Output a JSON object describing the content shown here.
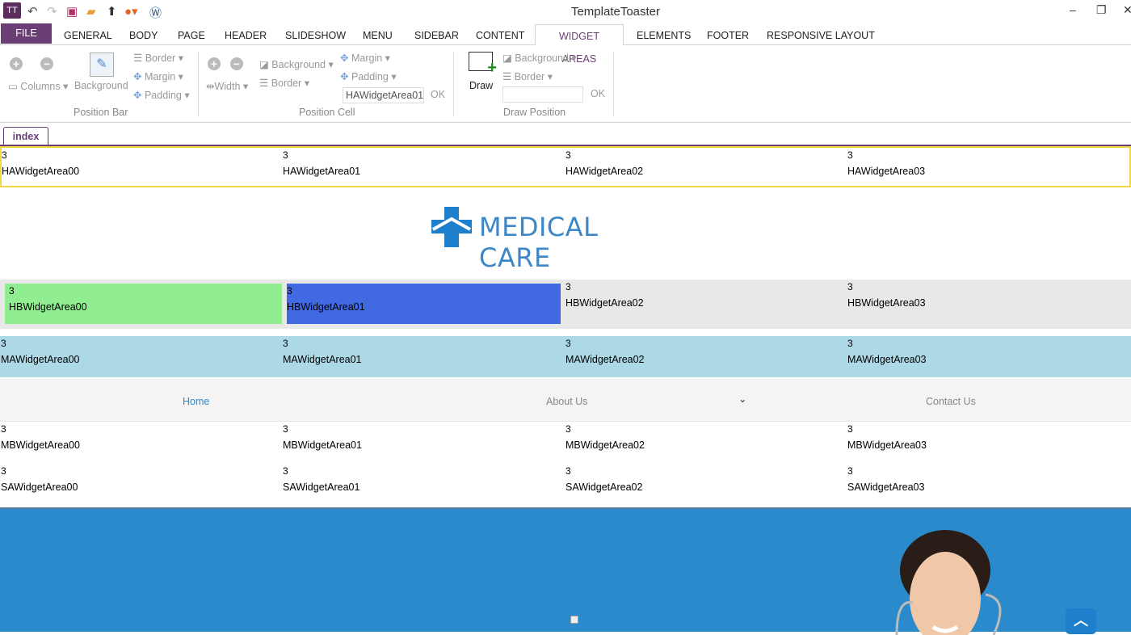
{
  "app": {
    "title": "TemplateToaster",
    "logo": "TT"
  },
  "quick_access": [
    "undo-icon",
    "redo-icon",
    "save-icon",
    "open-folder-icon",
    "upload-icon",
    "firefox-icon",
    "wordpress-icon"
  ],
  "tabs": [
    {
      "label": "FILE"
    },
    {
      "label": "GENERAL"
    },
    {
      "label": "BODY"
    },
    {
      "label": "PAGE"
    },
    {
      "label": "HEADER"
    },
    {
      "label": "SLIDESHOW"
    },
    {
      "label": "MENU"
    },
    {
      "label": "SIDEBAR"
    },
    {
      "label": "CONTENT"
    },
    {
      "label": "WIDGET AREAS"
    },
    {
      "label": "ELEMENTS"
    },
    {
      "label": "FOOTER"
    },
    {
      "label": "RESPONSIVE LAYOUT"
    }
  ],
  "ribbon": {
    "position_bar": {
      "label": "Position Bar",
      "columns": "Columns",
      "background": "Background",
      "border": "Border",
      "margin": "Margin",
      "padding": "Padding"
    },
    "position_cell": {
      "label": "Position Cell",
      "width": "Width",
      "background": "Background",
      "border": "Border",
      "margin": "Margin",
      "padding": "Padding",
      "name_value": "HAWidgetArea01",
      "ok": "OK"
    },
    "draw_position": {
      "label": "Draw Position",
      "draw": "Draw",
      "background": "Background",
      "border": "Border",
      "name_value": "",
      "ok": "OK"
    }
  },
  "doc_tab": "index",
  "ha": [
    {
      "n": "3",
      "l": "HAWidgetArea00"
    },
    {
      "n": "3",
      "l": "HAWidgetArea01"
    },
    {
      "n": "3",
      "l": "HAWidgetArea02"
    },
    {
      "n": "3",
      "l": "HAWidgetArea03"
    }
  ],
  "logo_text": "MEDICAL CARE",
  "hb": [
    {
      "n": "3",
      "l": "HBWidgetArea00"
    },
    {
      "n": "3",
      "l": "HBWidgetArea01"
    },
    {
      "n": "3",
      "l": "HBWidgetArea02"
    },
    {
      "n": "3",
      "l": "HBWidgetArea03"
    }
  ],
  "ma": [
    {
      "n": "3",
      "l": "MAWidgetArea00"
    },
    {
      "n": "3",
      "l": "MAWidgetArea01"
    },
    {
      "n": "3",
      "l": "MAWidgetArea02"
    },
    {
      "n": "3",
      "l": "MAWidgetArea03"
    }
  ],
  "nav": [
    {
      "label": "Home"
    },
    {
      "label": "About Us"
    },
    {
      "label": "Contact Us"
    }
  ],
  "mb": [
    {
      "n": "3",
      "l": "MBWidgetArea00"
    },
    {
      "n": "3",
      "l": "MBWidgetArea01"
    },
    {
      "n": "3",
      "l": "MBWidgetArea02"
    },
    {
      "n": "3",
      "l": "MBWidgetArea03"
    }
  ],
  "sa": [
    {
      "n": "3",
      "l": "SAWidgetArea00"
    },
    {
      "n": "3",
      "l": "SAWidgetArea01"
    },
    {
      "n": "3",
      "l": "SAWidgetArea02"
    },
    {
      "n": "3",
      "l": "SAWidgetArea03"
    }
  ],
  "colors": {
    "accent": "#6b3e75",
    "brand": "#2a8acb",
    "hb0": "#90ee90",
    "hb1": "#4169e1",
    "ma": "#add8e6"
  }
}
